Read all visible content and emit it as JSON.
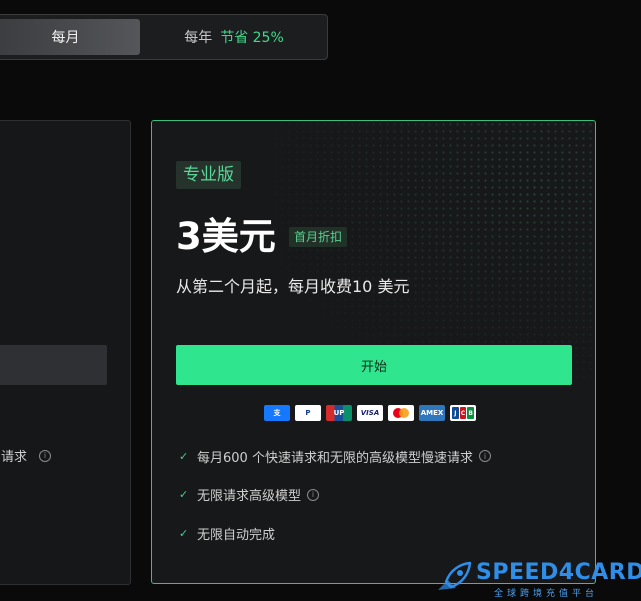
{
  "billing_toggle": {
    "monthly_label": "每月",
    "yearly_label": "每年",
    "save_label": "节省 25%"
  },
  "left_card": {
    "feature_fragment": "请求"
  },
  "pro_card": {
    "plan_name": "专业版",
    "price": "3美元",
    "discount_badge": "首月折扣",
    "subtitle": "从第二个月起，每月收费10 美元",
    "start_button": "开始",
    "payment_methods": [
      "alipay",
      "paypal",
      "unionpay",
      "visa",
      "mastercard",
      "amex",
      "jcb"
    ],
    "payment_labels": {
      "alipay": "支",
      "paypal": "P",
      "unionpay": "UP",
      "visa": "VISA",
      "amex": "AMEX"
    },
    "features": [
      {
        "text": "每月600 个快速请求和无限的高级模型慢速请求",
        "info": true
      },
      {
        "text": "无限请求高级模型",
        "info": true
      },
      {
        "text": "无限自动完成",
        "info": false
      }
    ]
  },
  "watermark": {
    "brand": "SPEED4CARD",
    "tagline": "全球跨境充值平台"
  },
  "colors": {
    "accent_green": "#2fe58d",
    "card_border_green": "#3ac07e",
    "background": "#0a0a0a"
  }
}
